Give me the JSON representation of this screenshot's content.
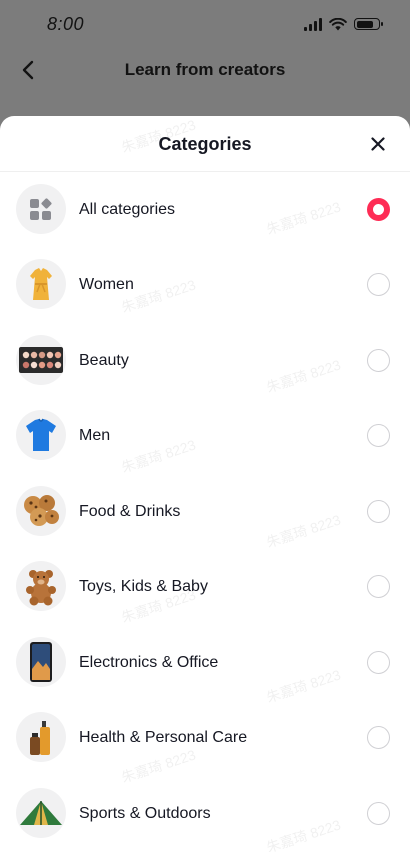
{
  "status_bar": {
    "time": "8:00"
  },
  "background_screen": {
    "title": "Learn from creators"
  },
  "sheet": {
    "title": "Categories",
    "categories": [
      {
        "label": "All categories",
        "icon": "grid-icon",
        "selected": true
      },
      {
        "label": "Women",
        "icon": "dress-icon",
        "selected": false
      },
      {
        "label": "Beauty",
        "icon": "eyeshadow-palette-icon",
        "selected": false
      },
      {
        "label": "Men",
        "icon": "shirt-icon",
        "selected": false
      },
      {
        "label": "Food & Drinks",
        "icon": "cookies-icon",
        "selected": false
      },
      {
        "label": "Toys, Kids & Baby",
        "icon": "teddy-bear-icon",
        "selected": false
      },
      {
        "label": "Electronics & Office",
        "icon": "smartphone-icon",
        "selected": false
      },
      {
        "label": "Health & Personal Care",
        "icon": "bottles-icon",
        "selected": false
      },
      {
        "label": "Sports & Outdoors",
        "icon": "tent-icon",
        "selected": false
      }
    ]
  },
  "watermark_text": "朱嘉琦 8223",
  "colors": {
    "accent": "#fe2c55",
    "radio_border": "#d0d0d4",
    "overlay": "#7c7c7c"
  }
}
